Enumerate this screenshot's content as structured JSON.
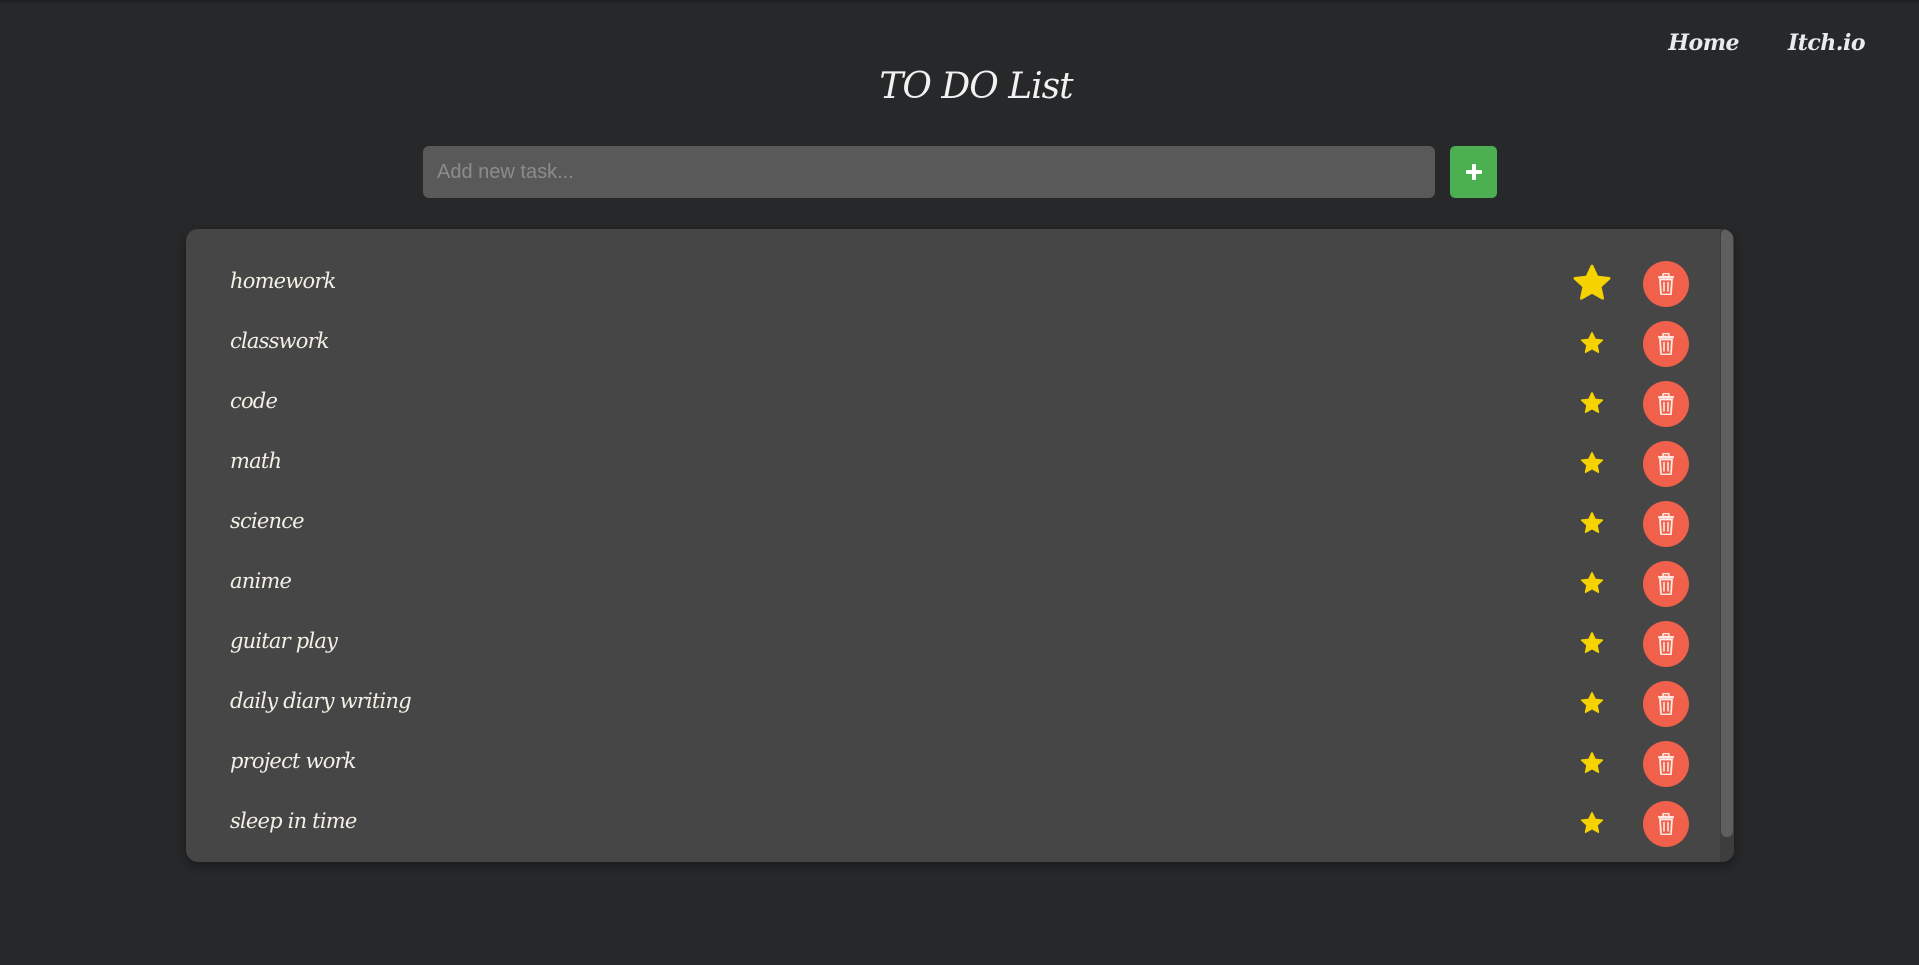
{
  "nav": {
    "home_label": "Home",
    "itch_label": "Itch.io"
  },
  "header": {
    "title": "TO DO List"
  },
  "add_task": {
    "placeholder": "Add new task...",
    "value": "",
    "button_icon": "plus-icon"
  },
  "tasks": [
    {
      "label": "homework",
      "starred": true,
      "star_icon": "star-icon",
      "delete_icon": "trash-icon"
    },
    {
      "label": "classwork",
      "starred": false,
      "star_icon": "star-icon",
      "delete_icon": "trash-icon"
    },
    {
      "label": "code",
      "starred": false,
      "star_icon": "star-icon",
      "delete_icon": "trash-icon"
    },
    {
      "label": "math",
      "starred": false,
      "star_icon": "star-icon",
      "delete_icon": "trash-icon"
    },
    {
      "label": "science",
      "starred": false,
      "star_icon": "star-icon",
      "delete_icon": "trash-icon"
    },
    {
      "label": "anime",
      "starred": false,
      "star_icon": "star-icon",
      "delete_icon": "trash-icon"
    },
    {
      "label": "guitar play",
      "starred": false,
      "star_icon": "star-icon",
      "delete_icon": "trash-icon"
    },
    {
      "label": "daily diary writing",
      "starred": false,
      "star_icon": "star-icon",
      "delete_icon": "trash-icon"
    },
    {
      "label": "project work",
      "starred": false,
      "star_icon": "star-icon",
      "delete_icon": "trash-icon"
    },
    {
      "label": "sleep in time",
      "starred": false,
      "star_icon": "star-icon",
      "delete_icon": "trash-icon"
    }
  ],
  "colors": {
    "background": "#27282a",
    "panel": "#464646",
    "input": "#595959",
    "add_button": "#4caf50",
    "star": "#f5d200",
    "delete_button": "#f0604a"
  }
}
